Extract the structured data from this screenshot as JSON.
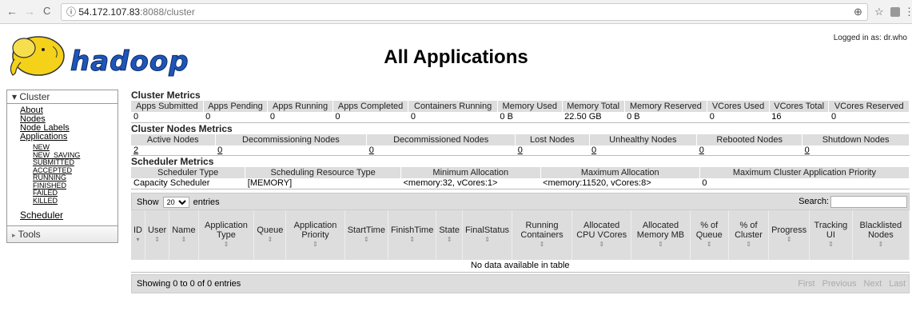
{
  "browser": {
    "back": "←",
    "forward": "→",
    "reload": "C",
    "info": "ⓘ",
    "url_host": "54.172.107.83",
    "url_rest": ":8088/cluster",
    "zoom": "⊕",
    "star": "☆",
    "menu": "⋮"
  },
  "header": {
    "title": "All Applications",
    "logged_in": "Logged in as: dr.who"
  },
  "sidebar": {
    "cluster_label": "Cluster",
    "links": [
      "About",
      "Nodes",
      "Node Labels",
      "Applications"
    ],
    "sub_links": [
      "NEW",
      "NEW_SAVING",
      "SUBMITTED",
      "ACCEPTED",
      "RUNNING",
      "FINISHED",
      "FAILED",
      "KILLED"
    ],
    "scheduler": "Scheduler",
    "tools_label": "Tools"
  },
  "cluster_metrics": {
    "title": "Cluster Metrics",
    "headers": [
      "Apps Submitted",
      "Apps Pending",
      "Apps Running",
      "Apps Completed",
      "Containers Running",
      "Memory Used",
      "Memory Total",
      "Memory Reserved",
      "VCores Used",
      "VCores Total",
      "VCores Reserved"
    ],
    "values": [
      "0",
      "0",
      "0",
      "0",
      "0",
      "0 B",
      "22.50 GB",
      "0 B",
      "0",
      "16",
      "0"
    ]
  },
  "node_metrics": {
    "title": "Cluster Nodes Metrics",
    "headers": [
      "Active Nodes",
      "Decommissioning Nodes",
      "Decommissioned Nodes",
      "Lost Nodes",
      "Unhealthy Nodes",
      "Rebooted Nodes",
      "Shutdown Nodes"
    ],
    "values": [
      "2",
      "0",
      "0",
      "0",
      "0",
      "0",
      "0"
    ]
  },
  "scheduler_metrics": {
    "title": "Scheduler Metrics",
    "headers": [
      "Scheduler Type",
      "Scheduling Resource Type",
      "Minimum Allocation",
      "Maximum Allocation",
      "Maximum Cluster Application Priority"
    ],
    "values": [
      "Capacity Scheduler",
      "[MEMORY]",
      "<memory:32, vCores:1>",
      "<memory:11520, vCores:8>",
      "0"
    ]
  },
  "apps": {
    "show_label": "Show",
    "entries_value": "20",
    "entries_label": "entries",
    "search_label": "Search:",
    "columns": [
      "ID",
      "User",
      "Name",
      "Application Type",
      "Queue",
      "Application Priority",
      "StartTime",
      "FinishTime",
      "State",
      "FinalStatus",
      "Running Containers",
      "Allocated CPU VCores",
      "Allocated Memory MB",
      "% of Queue",
      "% of Cluster",
      "Progress",
      "Tracking UI",
      "Blacklisted Nodes"
    ],
    "empty_message": "No data available in table",
    "footer_info": "Showing 0 to 0 of 0 entries",
    "pager": [
      "First",
      "Previous",
      "Next",
      "Last"
    ]
  }
}
